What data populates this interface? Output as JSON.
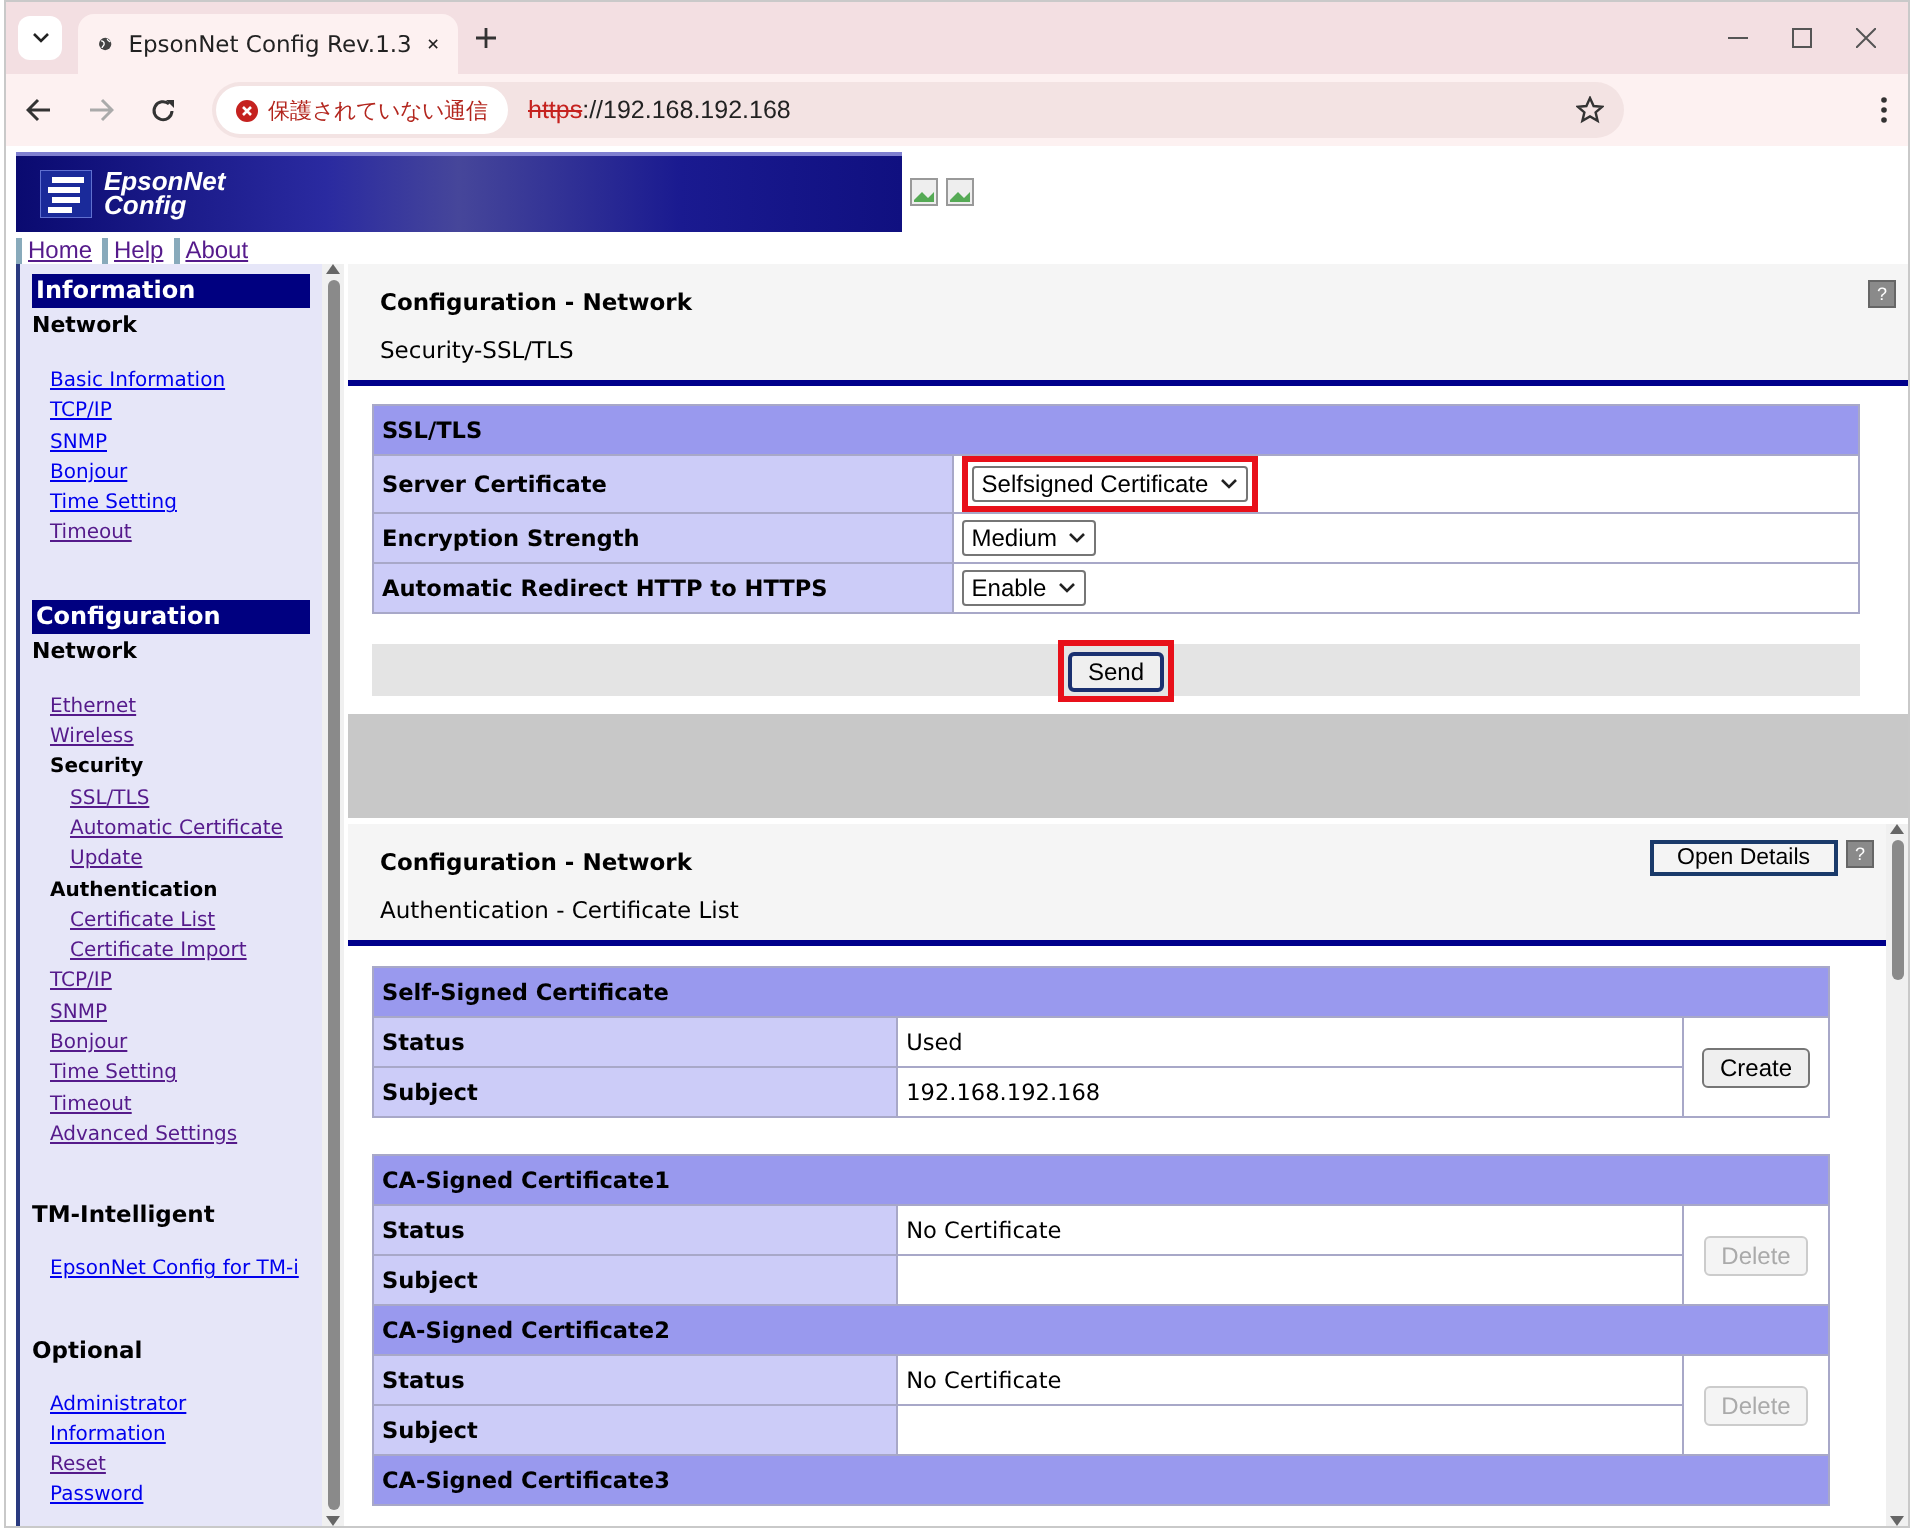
{
  "browser": {
    "tab_title": "EpsonNet Config Rev.1.3",
    "security_label": "保護されていない通信",
    "url_scheme": "https",
    "url_rest": "://192.168.192.168"
  },
  "banner": {
    "logo_line1": "EpsonNet",
    "logo_line2": "Config"
  },
  "top_nav": [
    "Home",
    "Help",
    "About"
  ],
  "sidebar": {
    "sections": [
      {
        "title": "Information",
        "kind": "banner",
        "items": [
          {
            "kind": "heading",
            "label": "Network"
          },
          {
            "kind": "link",
            "label": "Basic Information",
            "visited": false
          },
          {
            "kind": "link",
            "label": "TCP/IP",
            "visited": false
          },
          {
            "kind": "link",
            "label": "SNMP",
            "visited": false
          },
          {
            "kind": "link",
            "label": "Bonjour",
            "visited": false
          },
          {
            "kind": "link",
            "label": "Time Setting",
            "visited": false
          },
          {
            "kind": "link",
            "label": "Timeout",
            "visited": true
          }
        ]
      },
      {
        "title": "Configuration",
        "kind": "banner",
        "items": [
          {
            "kind": "heading",
            "label": "Network"
          },
          {
            "kind": "link",
            "label": "Ethernet",
            "visited": true
          },
          {
            "kind": "link",
            "label": "Wireless",
            "visited": true
          },
          {
            "kind": "group",
            "label": "Security",
            "children": [
              {
                "kind": "link",
                "label": "SSL/TLS",
                "visited": true
              },
              {
                "kind": "link",
                "label": "Automatic Certificate",
                "visited": true
              },
              {
                "kind": "link",
                "label": "Update",
                "visited": true
              }
            ]
          },
          {
            "kind": "group",
            "label": "Authentication",
            "children": [
              {
                "kind": "link",
                "label": "Certificate List",
                "visited": true
              },
              {
                "kind": "link",
                "label": "Certificate Import",
                "visited": true
              }
            ]
          },
          {
            "kind": "link",
            "label": "TCP/IP",
            "visited": true
          },
          {
            "kind": "link",
            "label": "SNMP",
            "visited": true
          },
          {
            "kind": "link",
            "label": "Bonjour",
            "visited": true
          },
          {
            "kind": "link",
            "label": "Time Setting",
            "visited": true
          },
          {
            "kind": "link",
            "label": "Timeout",
            "visited": true
          },
          {
            "kind": "link",
            "label": "Advanced Settings",
            "visited": true
          }
        ]
      },
      {
        "title": "TM-Intelligent",
        "kind": "plain",
        "items": [
          {
            "kind": "link",
            "label": "EpsonNet Config for TM-i",
            "visited": false
          }
        ]
      },
      {
        "title": "Optional",
        "kind": "plain",
        "items": [
          {
            "kind": "link",
            "label": "Administrator",
            "visited": false
          },
          {
            "kind": "link",
            "label": "Information",
            "visited": false
          },
          {
            "kind": "link",
            "label": "Reset",
            "visited": true
          },
          {
            "kind": "link",
            "label": "Password",
            "visited": false
          }
        ]
      }
    ]
  },
  "ssl_panel": {
    "title": "Configuration - Network",
    "subtitle": "Security-SSL/TLS",
    "help": "?",
    "table_title": "SSL/TLS",
    "rows": [
      {
        "label": "Server Certificate",
        "value": "Selfsigned Certificate",
        "highlighted": true
      },
      {
        "label": "Encryption Strength",
        "value": "Medium",
        "highlighted": false
      },
      {
        "label": "Automatic Redirect HTTP to HTTPS",
        "value": "Enable",
        "highlighted": false
      }
    ],
    "send": {
      "label": "Send",
      "highlighted": true
    }
  },
  "cert_panel": {
    "title": "Configuration - Network",
    "subtitle": "Authentication - Certificate List",
    "details_button": "Open Details",
    "help": "?",
    "tables": [
      {
        "certificates": [
          {
            "title": "Self-Signed Certificate",
            "rows": [
              {
                "label": "Status",
                "value": "Used"
              },
              {
                "label": "Subject",
                "value": "192.168.192.168"
              }
            ],
            "action": {
              "label": "Create",
              "disabled": false
            }
          }
        ]
      },
      {
        "certificates": [
          {
            "title": "CA-Signed Certificate1",
            "rows": [
              {
                "label": "Status",
                "value": "No Certificate"
              },
              {
                "label": "Subject"
              }
            ],
            "action": {
              "label": "Delete",
              "disabled": true
            }
          },
          {
            "title": "CA-Signed Certificate2",
            "rows": [
              {
                "label": "Status",
                "value": "No Certificate"
              },
              {
                "label": "Subject"
              }
            ],
            "action": {
              "label": "Delete",
              "disabled": true
            }
          },
          {
            "title": "CA-Signed Certificate3"
          }
        ]
      }
    ]
  }
}
